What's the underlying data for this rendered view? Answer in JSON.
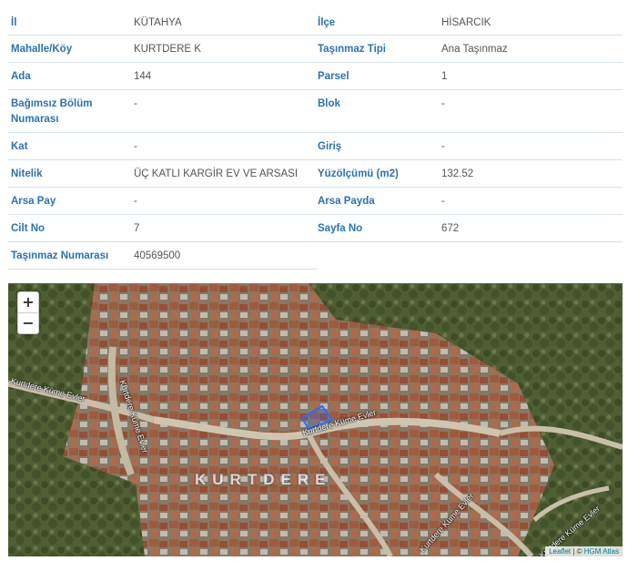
{
  "property": {
    "rows": [
      {
        "l1": "İl",
        "v1": "KÜTAHYA",
        "l2": "İlçe",
        "v2": "HİSARCIK"
      },
      {
        "l1": "Mahalle/Köy",
        "v1": "KURTDERE K",
        "l2": "Taşınmaz Tipi",
        "v2": "Ana Taşınmaz"
      },
      {
        "l1": "Ada",
        "v1": "144",
        "l2": "Parsel",
        "v2": "1"
      },
      {
        "l1": "Bağımsız Bölüm Numarası",
        "v1": "-",
        "l2": "Blok",
        "v2": "-"
      },
      {
        "l1": "Kat",
        "v1": "-",
        "l2": "Giriş",
        "v2": "-"
      },
      {
        "l1": "Nitelik",
        "v1": "ÜÇ KATLI KARGİR EV VE ARSASI",
        "l2": "Yüzölçümü (m2)",
        "v2": "132.52"
      },
      {
        "l1": "Arsa Pay",
        "v1": "-",
        "l2": "Arsa Payda",
        "v2": "-"
      },
      {
        "l1": "Cilt No",
        "v1": "7",
        "l2": "Sayfa No",
        "v2": "672"
      }
    ],
    "last": {
      "l1": "Taşınmaz Numarası",
      "v1": "40569500"
    }
  },
  "map": {
    "zoom_in": "+",
    "zoom_out": "−",
    "streets": {
      "s1": "Kurtdere Küme Evler",
      "s2": "Kurtdere Küme Evler",
      "s3": "Kurtdere Küme Evler",
      "s4": "Kurtdere Küme Evler",
      "s5": "Kurtdere Küme Evler"
    },
    "place_label": "KURTDERE",
    "attribution": {
      "leaflet": "Leaflet",
      "sep": " | © ",
      "hgm": "HGM Atlas"
    },
    "parcel_color": "#2b6cff"
  }
}
